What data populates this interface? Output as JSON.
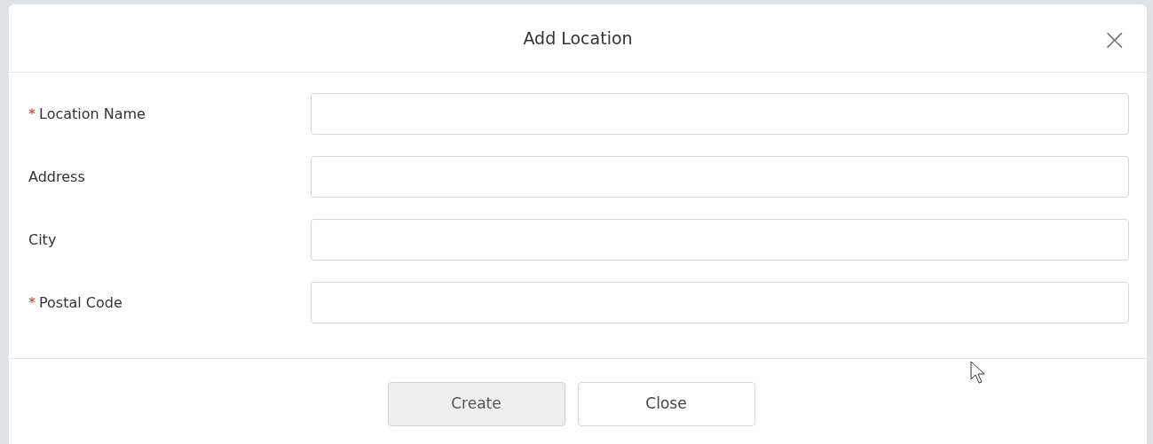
{
  "dialog": {
    "title": "Add Location",
    "close_symbol": "×",
    "fields": [
      {
        "label": "Location Name",
        "required_mark": "*"
      },
      {
        "label": "Address"
      },
      {
        "label": "City"
      },
      {
        "label": "Postal Code",
        "required_mark": "*"
      }
    ],
    "buttons": [
      {
        "label": "Create",
        "disabled": true
      },
      {
        "label": "Close",
        "disabled": false
      }
    ]
  }
}
